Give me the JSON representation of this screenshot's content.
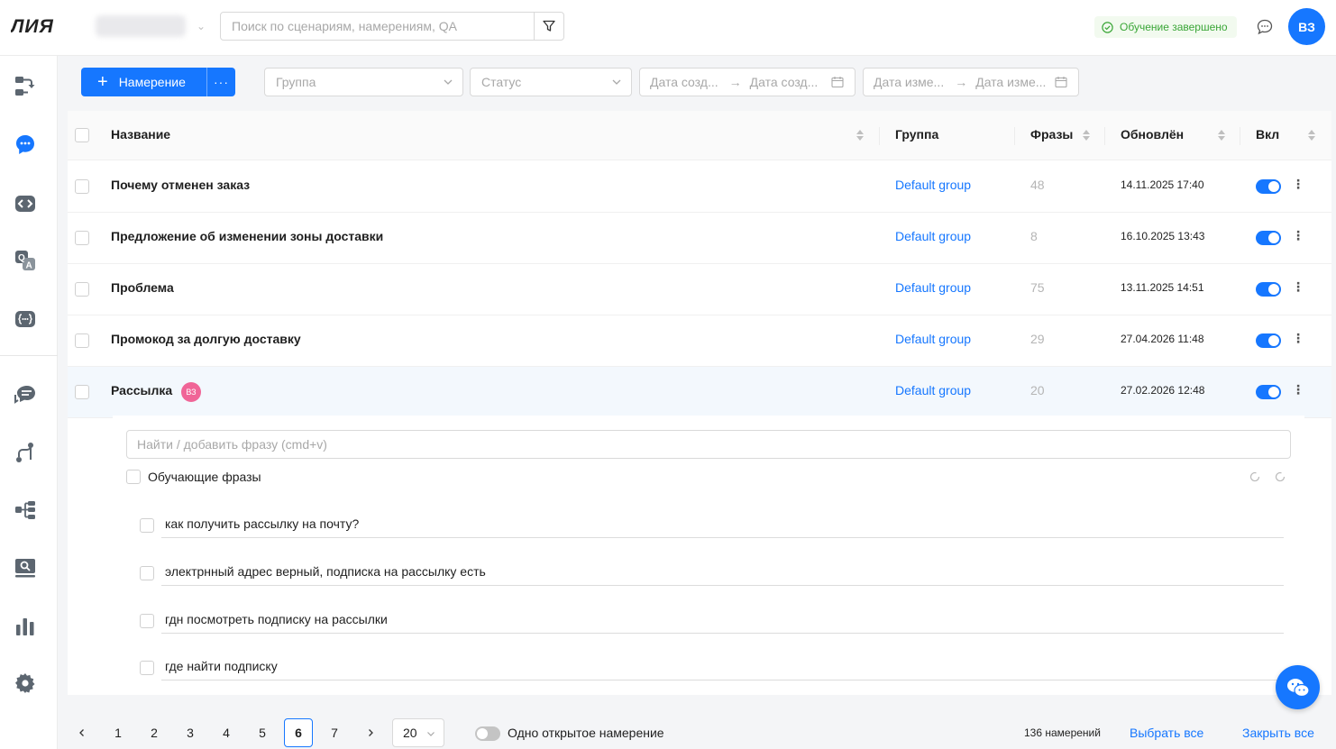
{
  "app": {
    "logo_text": "ЛИЯ"
  },
  "header": {
    "search_placeholder": "Поиск по сценариям, намерениям, QA",
    "status_text": "Обучение завершено",
    "avatar_initials": "ВЗ"
  },
  "toolbar": {
    "add_button_label": "Намерение",
    "more_label": "···",
    "group_placeholder": "Группа",
    "status_placeholder": "Статус",
    "created_from": "Дата созд...",
    "created_to": "Дата созд...",
    "modified_from": "Дата изме...",
    "modified_to": "Дата изме..."
  },
  "table": {
    "columns": {
      "name": "Название",
      "group": "Группа",
      "phrases": "Фразы",
      "updated": "Обновлён",
      "enabled": "Вкл"
    },
    "rows": [
      {
        "name": "Почему отменен заказ",
        "group": "Default group",
        "phrases": "48",
        "updated": "14.11.2025 17:40",
        "enabled": true
      },
      {
        "name": "Предложение об изменении зоны доставки",
        "group": "Default group",
        "phrases": "8",
        "updated": "16.10.2025 13:43",
        "enabled": true
      },
      {
        "name": "Проблема",
        "group": "Default group",
        "phrases": "75",
        "updated": "13.11.2025 14:51",
        "enabled": true
      },
      {
        "name": "Промокод за долгую доставку",
        "group": "Default group",
        "phrases": "29",
        "updated": "27.04.2026 11:48",
        "enabled": true
      },
      {
        "name": "Рассылка",
        "badge": "ВЗ",
        "group": "Default group",
        "phrases": "20",
        "updated": "27.02.2026 12:48",
        "enabled": true
      }
    ]
  },
  "expanded": {
    "input_placeholder": "Найти / добавить фразу (cmd+v)",
    "section_label": "Обучающие фразы",
    "phrases": [
      "как получить рассылку на почту?",
      "электрнный адрес верный, подписка на рассылку есть",
      "гдн посмотреть подписку на рассылки",
      "где найти подписку"
    ]
  },
  "pagination": {
    "pages": [
      "1",
      "2",
      "3",
      "4",
      "5",
      "6",
      "7"
    ],
    "current": "6",
    "page_size": "20",
    "single_open_label": "Одно открытое намерение",
    "total": "136 намерений",
    "select_all": "Выбрать все",
    "close_all": "Закрыть все"
  },
  "colors": {
    "accent": "#1677ff",
    "success": "#3aa637",
    "badge": "#f06597"
  }
}
